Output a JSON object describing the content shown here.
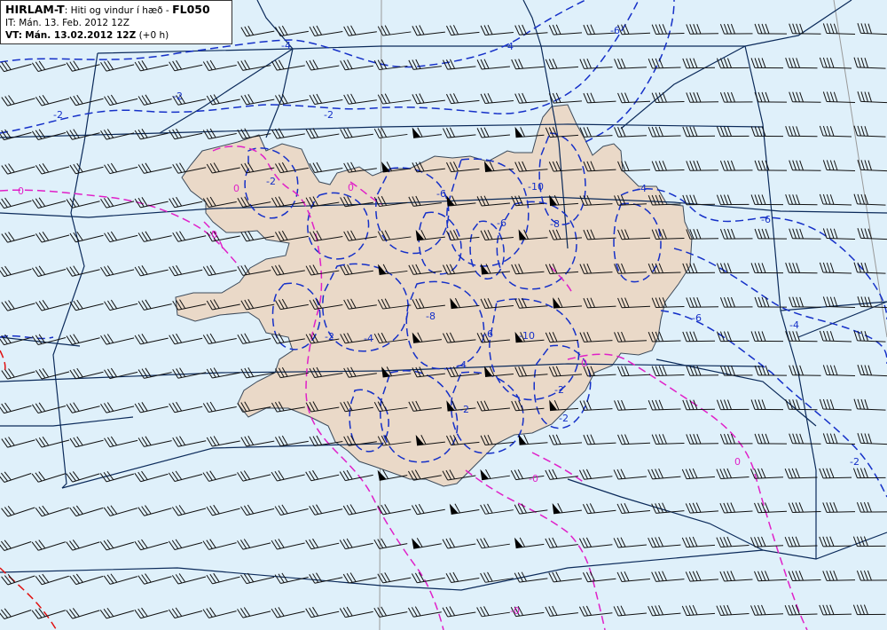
{
  "legend": {
    "model": "HIRLAM-T",
    "desc": ": Hiti og vindur í hæð - ",
    "level": "FL050",
    "it_line": "IT: Mán. 13. Feb. 2012 12Z",
    "vt_label": "VT:",
    "vt_value": "Mán. 13.02.2012 12Z",
    "vt_offset": "(+0 h)"
  },
  "contour_labels": {
    "blue": [
      "4",
      "-6",
      "-2",
      "-2",
      "-4",
      "-2",
      "-4",
      "-4",
      "-6",
      "-6",
      "-4",
      "-2",
      "-8",
      "-10",
      "-10",
      "-6",
      "-4",
      "-2",
      "-2",
      "-2",
      "-6",
      "-2",
      "-8",
      "-6",
      "-2"
    ],
    "magenta": [
      "0",
      "0",
      "-0",
      "0",
      "0",
      "0",
      "0",
      "-0"
    ]
  },
  "colors": {
    "sea": "#dff0fa",
    "land": "#ead9c8",
    "grid": "#0b2a5a",
    "blue_contour": "#1530c8",
    "magenta_contour": "#e020c8",
    "red_contour": "#e01010"
  }
}
